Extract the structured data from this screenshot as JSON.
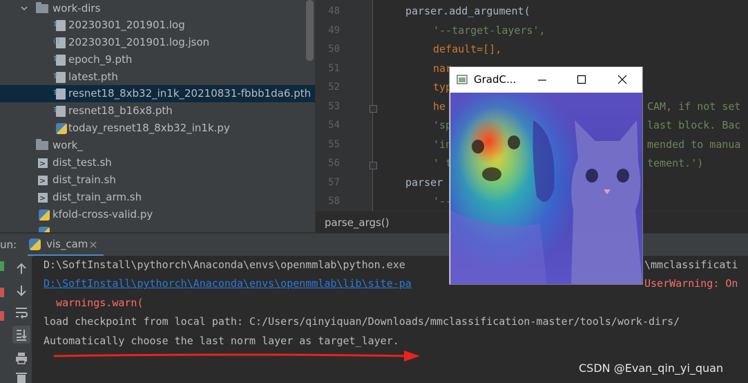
{
  "project_tree": {
    "items": [
      {
        "label": "work-dirs",
        "kind": "folder",
        "expanded": true
      },
      {
        "label": "20230301_201901.log",
        "kind": "log"
      },
      {
        "label": "20230301_201901.log.json",
        "kind": "json"
      },
      {
        "label": "epoch_9.pth",
        "kind": "pth"
      },
      {
        "label": "latest.pth",
        "kind": "pth"
      },
      {
        "label": "resnet18_8xb32_in1k_20210831-fbbb1da6.pth",
        "kind": "pth",
        "selected": true
      },
      {
        "label": "resnet18_b16x8.pth",
        "kind": "pth"
      },
      {
        "label": "today_resnet18_8xb32_in1k.py",
        "kind": "py"
      },
      {
        "label": "work_",
        "kind": "folder"
      },
      {
        "label": "dist_test.sh",
        "kind": "sh"
      },
      {
        "label": "dist_train.sh",
        "kind": "sh"
      },
      {
        "label": "dist_train_arm.sh",
        "kind": "sh"
      },
      {
        "label": "kfold-cross-valid.py",
        "kind": "py"
      }
    ]
  },
  "editor": {
    "line_numbers": [
      "48",
      "49",
      "50",
      "51",
      "52",
      "53",
      "54",
      "55",
      "56",
      "57",
      "58"
    ],
    "lines": [
      {
        "text": "parser.add_argument(",
        "color": "#a9b7c6"
      },
      {
        "text": "'--target-layers',",
        "color": "#6a8759"
      },
      {
        "text": "default=[],",
        "color": "#cc7832"
      },
      {
        "text": "nar",
        "color": "#cc7832"
      },
      {
        "text": "typ",
        "color": "#cc7832"
      },
      {
        "text": "he",
        "color": "#cc7832",
        "tail": "CAM, if not set"
      },
      {
        "text": "'sp",
        "color": "#6a8759",
        "tail": "last block. Bac"
      },
      {
        "text": "'in",
        "color": "#6a8759",
        "tail": "mended to manua"
      },
      {
        "text": "' t",
        "color": "#6a8759",
        "tail": "tement.')"
      },
      {
        "text": "parser",
        "color": "#a9b7c6"
      },
      {
        "text": "'--",
        "color": "#6a8759"
      }
    ],
    "breadcrumb": "parse_args()"
  },
  "run": {
    "label": "un:",
    "tab_label": "vis_cam",
    "console_lines": [
      {
        "text": "D:\\SoftInstall\\pythorch\\Anaconda\\envs\\openmmlab\\python.exe",
        "color": "#bbbbbb",
        "tail": "\\mmclassificati"
      },
      {
        "text": "D:\\SoftInstall\\pythorch\\Anaconda\\envs\\openmmlab\\lib\\site-pa",
        "color": "#287bde",
        "tail": "UserWarning: On"
      },
      {
        "text": "  warnings.warn(",
        "color": "#ff6b68"
      },
      {
        "text": "load checkpoint from local path: C:/Users/qinyiquan/Downloads/mmclassification-master/tools/work-dirs/",
        "color": "#bbbbbb"
      },
      {
        "text": "Automatically choose the last norm layer as target_layer.",
        "color": "#bbbbbb"
      }
    ]
  },
  "popup": {
    "title": "GradC..."
  },
  "watermark": "CSDN @Evan_qin_yi_quan",
  "colors": {
    "arrow": "#e8231f",
    "selection": "#0d293e"
  }
}
